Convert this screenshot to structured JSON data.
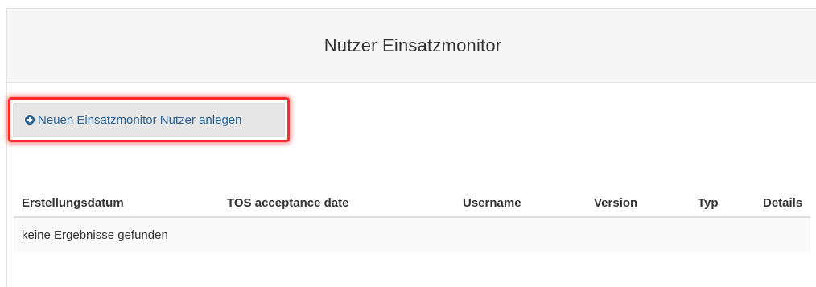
{
  "panel": {
    "title": "Nutzer Einsatzmonitor"
  },
  "toolbar": {
    "add_button_label": "Neuen Einsatzmonitor Nutzer anlegen",
    "add_button_icon": "plus-circle-icon",
    "highlight_color": "#ff2b2b",
    "link_color": "#2a6496"
  },
  "table": {
    "columns": [
      "Erstellungsdatum",
      "TOS acceptance date",
      "Username",
      "Version",
      "Typ",
      "Details"
    ],
    "empty_message": "keine Ergebnisse gefunden"
  }
}
